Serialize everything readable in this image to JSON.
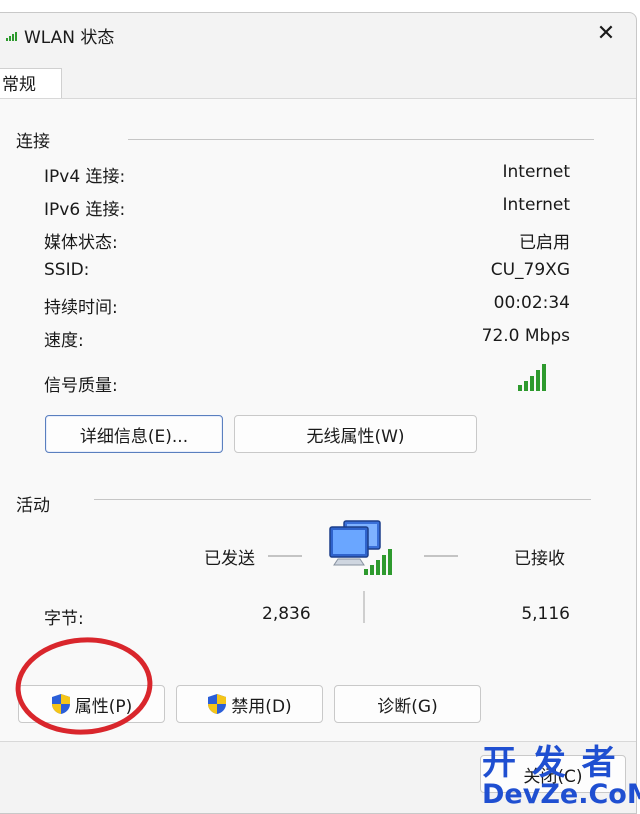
{
  "window": {
    "title": "WLAN 状态",
    "close_symbol": "✕"
  },
  "tabs": [
    {
      "label": "常规"
    }
  ],
  "connection": {
    "group_label": "连接",
    "rows": [
      {
        "label": "IPv4 连接:",
        "value": "Internet"
      },
      {
        "label": "IPv6 连接:",
        "value": "Internet"
      },
      {
        "label": "媒体状态:",
        "value": "已启用"
      },
      {
        "label": "SSID:",
        "value": "CU_79XG"
      },
      {
        "label": "持续时间:",
        "value": "00:02:34"
      },
      {
        "label": "速度:",
        "value": "72.0 Mbps"
      }
    ],
    "signal_label": "信号质量:",
    "signal_bars": 5,
    "details_button": "详细信息(E)...",
    "wireless_props_button": "无线属性(W)"
  },
  "activity": {
    "group_label": "活动",
    "sent_label": "已发送",
    "received_label": "已接收",
    "bytes_label": "字节:",
    "bytes_sent": "2,836",
    "bytes_received": "5,116"
  },
  "actions": {
    "properties_button": "属性(P)",
    "disable_button": "禁用(D)",
    "diagnose_button": "诊断(G)"
  },
  "footer": {
    "close_button": "关闭(C)"
  },
  "watermark": {
    "line1": "开 发 者",
    "line2": "DevZe.CoM"
  },
  "icons": {
    "signal": "signal-bars-icon",
    "network": "network-computers-icon",
    "shield": "uac-shield-icon",
    "close": "close-icon"
  },
  "colors": {
    "signal_green": "#2e9a2e",
    "annotation_red": "#d9262c",
    "watermark_blue": "#1f4fd1",
    "button_focus": "#5a7fbf"
  }
}
